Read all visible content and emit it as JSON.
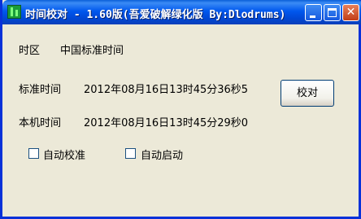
{
  "window": {
    "title": "时间校对 - 1.60版(吾爱破解绿化版 By:Dlodrums)"
  },
  "timezone": {
    "label": "时区",
    "value": "中国标准时间"
  },
  "standard_time": {
    "label": "标准时间",
    "value": "2012年08月16日13时45分36秒5"
  },
  "local_time": {
    "label": "本机时间",
    "value": "2012年08月16日13时45分29秒0"
  },
  "buttons": {
    "calibrate_label": "校对"
  },
  "options": {
    "auto_calibrate": "自动校准",
    "auto_start": "自动启动"
  }
}
